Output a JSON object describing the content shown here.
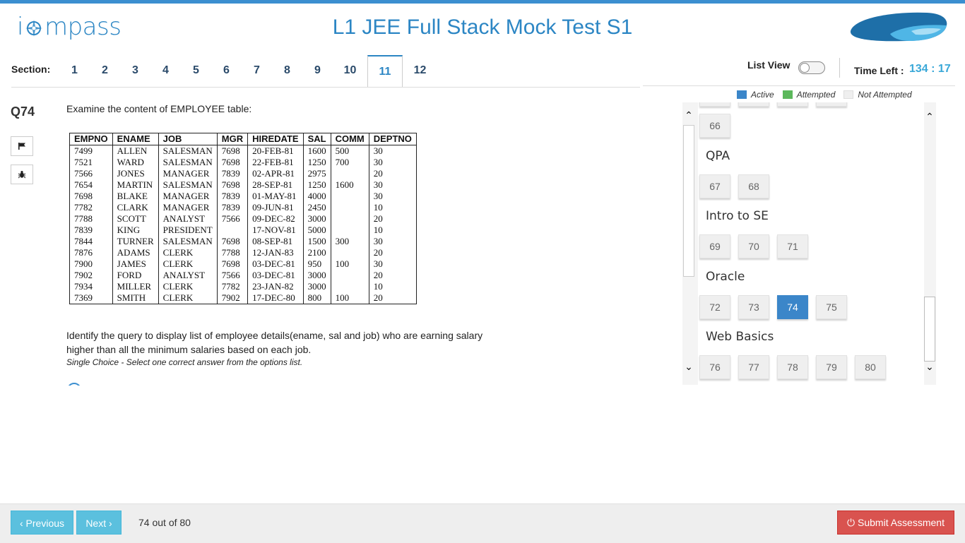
{
  "header": {
    "logo_text_1": "i",
    "logo_text_2": "mpass",
    "title": "L1 JEE Full Stack Mock Test S1"
  },
  "sections": {
    "label": "Section:",
    "tabs": [
      "1",
      "2",
      "3",
      "4",
      "5",
      "6",
      "7",
      "8",
      "9",
      "10",
      "11",
      "12"
    ],
    "active": "11"
  },
  "controls": {
    "list_view_label": "List View",
    "list_view_on": false,
    "time_left_label": "Time Left :",
    "time_left_value": "134 : 17"
  },
  "question": {
    "number": "Q74",
    "intro": "Examine the content of EMPLOYEE table:",
    "table": {
      "headers": [
        "EMPNO",
        "ENAME",
        "JOB",
        "MGR",
        "HIREDATE",
        "SAL",
        "COMM",
        "DEPTNO"
      ],
      "rows": [
        [
          " 7499",
          "ALLEN",
          "SALESMAN",
          "7698",
          "20-FEB-81",
          "1600",
          "500",
          "30"
        ],
        [
          " 7521",
          "WARD",
          "SALESMAN",
          "7698",
          "22-FEB-81",
          "1250",
          "700",
          "30"
        ],
        [
          "7566",
          "JONES",
          "MANAGER",
          "7839",
          "02-APR-81",
          "2975",
          "",
          "20"
        ],
        [
          "7654",
          "MARTIN",
          "SALESMAN",
          "7698",
          "28-SEP-81",
          "1250",
          "1600",
          "30"
        ],
        [
          "7698",
          "BLAKE",
          "MANAGER",
          "7839",
          "01-MAY-81",
          "4000",
          "",
          "30"
        ],
        [
          "7782",
          "CLARK",
          "MANAGER",
          "7839",
          "09-JUN-81",
          "2450",
          "",
          "10"
        ],
        [
          "7788",
          "SCOTT",
          "ANALYST",
          "7566",
          "09-DEC-82",
          "3000",
          "",
          "20"
        ],
        [
          "7839",
          "KING",
          "PRESIDENT",
          "",
          "17-NOV-81",
          "5000",
          "",
          "10"
        ],
        [
          "7844",
          "TURNER",
          "SALESMAN",
          "7698",
          "08-SEP-81",
          "1500",
          "300",
          "30"
        ],
        [
          "7876",
          "ADAMS",
          "CLERK",
          "7788",
          "12-JAN-83",
          "2100",
          "",
          "20"
        ],
        [
          "7900",
          "JAMES",
          "CLERK",
          "7698",
          "03-DEC-81",
          "950",
          "100",
          "30"
        ],
        [
          "7902",
          "FORD",
          "ANALYST",
          "7566",
          "03-DEC-81",
          "3000",
          "",
          "20"
        ],
        [
          "7934",
          "MILLER",
          "CLERK",
          "7782",
          "23-JAN-82",
          "3000",
          "",
          "10"
        ],
        [
          "7369",
          "SMITH",
          "CLERK",
          "7902",
          "17-DEC-80",
          "800",
          "100",
          "20"
        ]
      ]
    },
    "prompt": "Identify the query to display list of employee details(ename, sal and job) who are earning salary higher than all the minimum salaries based on each job.",
    "hint": "Single Choice - Select one correct answer from the options list."
  },
  "legend": {
    "active": "Active",
    "attempted": "Attempted",
    "not_attempted": "Not Attempted",
    "colors": {
      "active": "#3b86c9",
      "attempted": "#5cb85c",
      "not_attempted": "#efefef"
    }
  },
  "palette": {
    "groups": [
      {
        "title": "",
        "questions": [
          "66"
        ]
      },
      {
        "title": "QPA",
        "questions": [
          "67",
          "68"
        ]
      },
      {
        "title": "Intro to SE",
        "questions": [
          "69",
          "70",
          "71"
        ]
      },
      {
        "title": "Oracle",
        "questions": [
          "72",
          "73",
          "74",
          "75"
        ]
      },
      {
        "title": "Web Basics",
        "questions": [
          "76",
          "77",
          "78",
          "79",
          "80"
        ]
      }
    ],
    "active_question": "74"
  },
  "footer": {
    "previous_label": "Previous",
    "next_label": "Next",
    "counter": "74 out of 80",
    "submit_label": "Submit Assessment"
  }
}
